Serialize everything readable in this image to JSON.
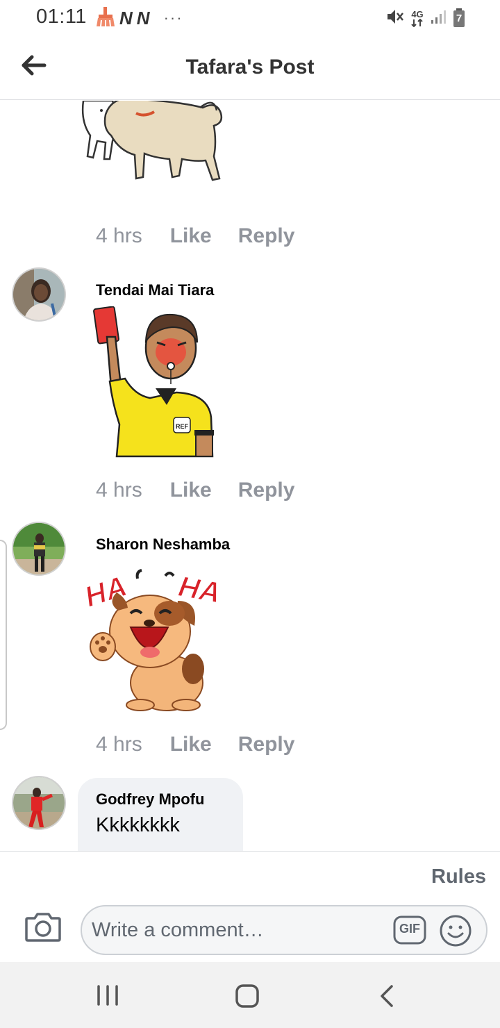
{
  "status_bar": {
    "time": "01:11",
    "notification_icons": [
      "cleaner-icon",
      "n-app-icon",
      "n-app-icon",
      "more-dots-icon"
    ],
    "n_glyph": "N",
    "dots": "···",
    "network_label_top": "4G",
    "system_icons": [
      "mute-icon",
      "network-4g-icon",
      "signal-icon",
      "battery-icon"
    ],
    "battery_level": "7"
  },
  "header": {
    "title": "Tafara's Post",
    "back_icon": "back-arrow-icon"
  },
  "comments": [
    {
      "sticker": "dog-sticker",
      "time": "4 hrs",
      "like": "Like",
      "reply": "Reply"
    },
    {
      "author": "Tendai Mai Tiara",
      "sticker": "referee-red-card-sticker",
      "time": "4 hrs",
      "like": "Like",
      "reply": "Reply"
    },
    {
      "author": "Sharon Neshamba",
      "sticker": "haha-dog-sticker",
      "sticker_text_left": "HA",
      "sticker_text_right": "HA",
      "time": "4 hrs",
      "like": "Like",
      "reply": "Reply"
    },
    {
      "author": "Godfrey Mpofu",
      "text": "Kkkkkkkk"
    }
  ],
  "footer": {
    "rules": "Rules",
    "camera_icon": "camera-icon",
    "placeholder": "Write a comment…",
    "gif_label": "GIF",
    "emoji_icon": "smiley-icon"
  },
  "nav_bar": {
    "icons": [
      "recent-apps-icon",
      "home-icon",
      "back-icon"
    ]
  },
  "colors": {
    "meta_text": "#90949c",
    "bubble_bg": "#f0f2f5",
    "referee_shirt": "#f5e21c",
    "red_card": "#e53935"
  }
}
